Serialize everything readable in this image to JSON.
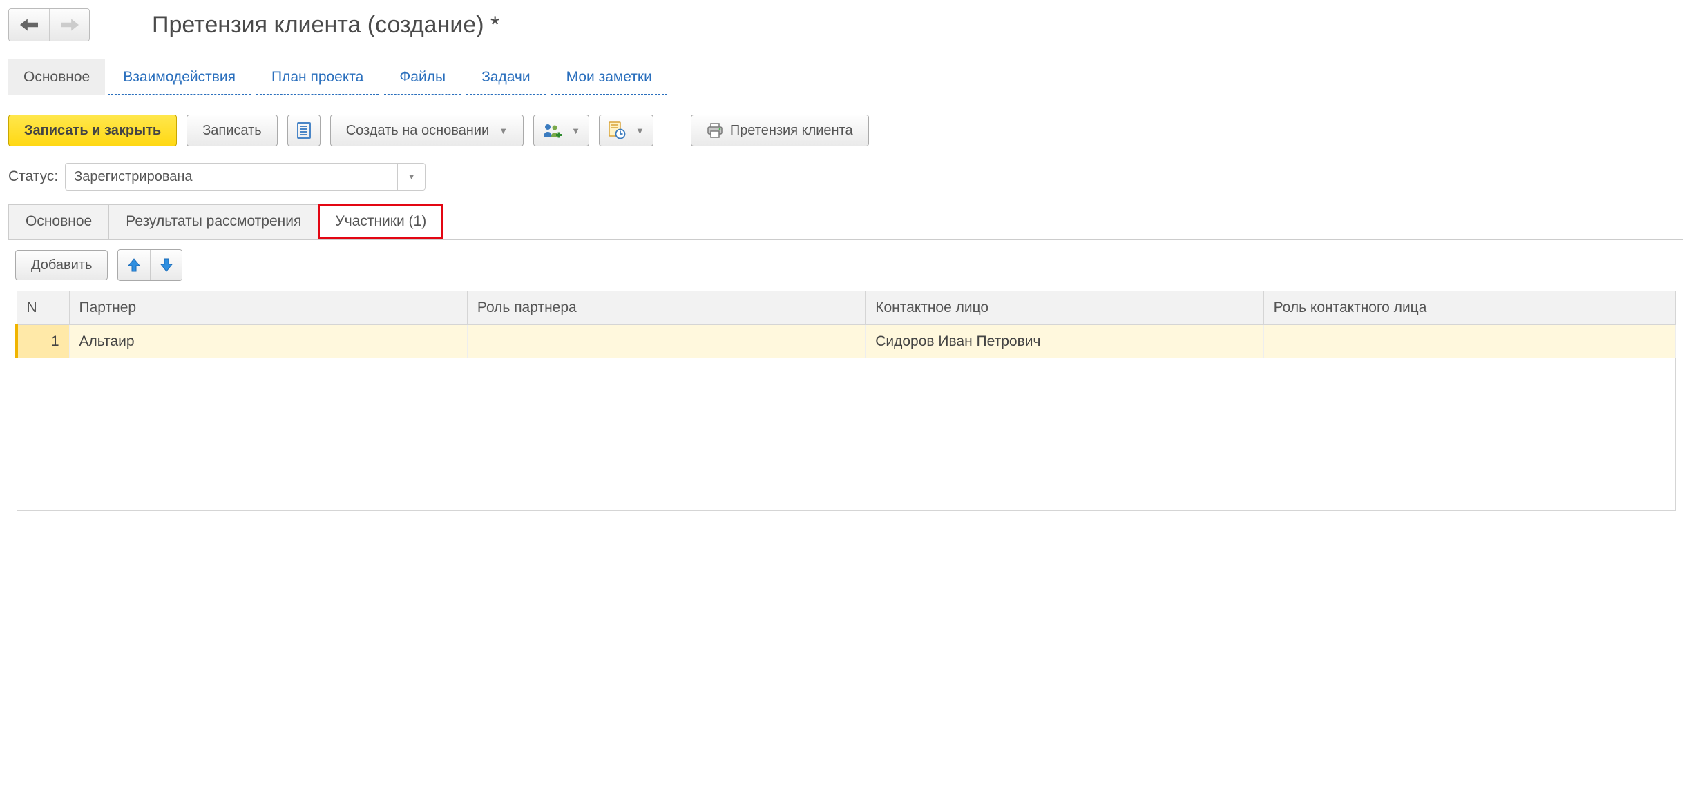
{
  "header": {
    "title": "Претензия клиента (создание) *"
  },
  "nav": {
    "active": "Основное",
    "links": [
      "Взаимодействия",
      "План проекта",
      "Файлы",
      "Задачи",
      "Мои заметки"
    ]
  },
  "toolbar": {
    "write_close": "Записать и закрыть",
    "write": "Записать",
    "create_based": "Создать на основании",
    "print_claim": "Претензия клиента"
  },
  "status": {
    "label": "Статус:",
    "value": "Зарегистрирована"
  },
  "tabs": {
    "items": [
      "Основное",
      "Результаты рассмотрения",
      "Участники (1)"
    ],
    "selected_index": 2
  },
  "panel": {
    "add": "Добавить"
  },
  "table": {
    "columns": [
      "N",
      "Партнер",
      "Роль партнера",
      "Контактное лицо",
      "Роль контактного лица"
    ],
    "rows": [
      {
        "n": "1",
        "partner": "Альтаир",
        "partner_role": "",
        "contact": "Сидоров Иван Петрович",
        "contact_role": ""
      }
    ]
  }
}
